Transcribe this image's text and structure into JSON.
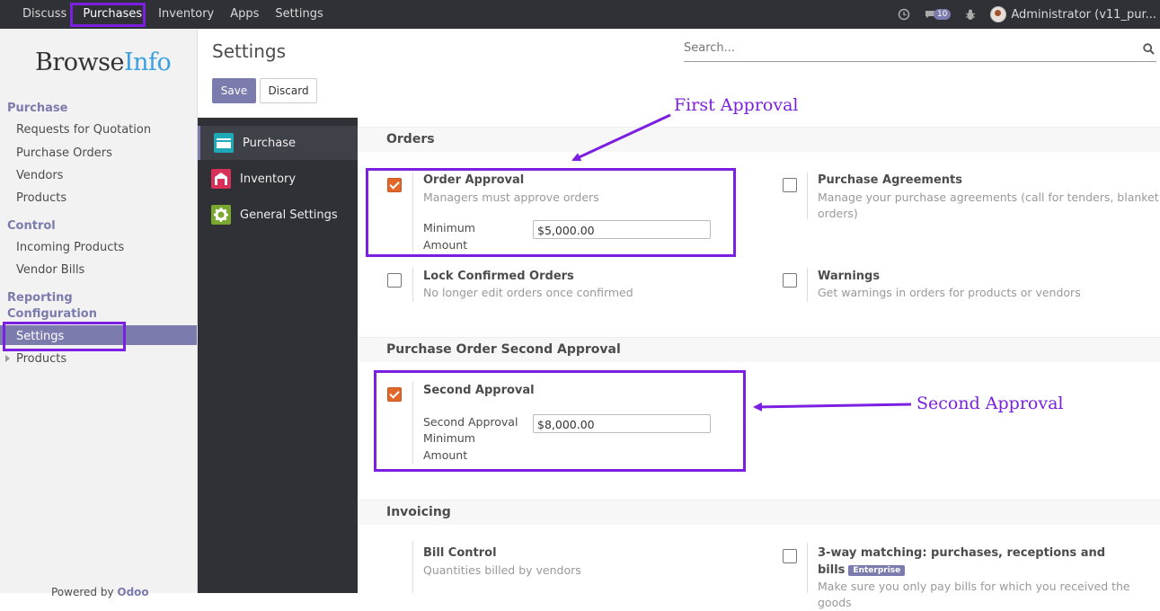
{
  "topbar": {
    "menu": [
      "Discuss",
      "Purchases",
      "Inventory",
      "Apps",
      "Settings"
    ],
    "messages_count": "10",
    "user": "Administrator (v11_pur..."
  },
  "sidebar": {
    "logo_a": "Browse",
    "logo_b": "Info",
    "sections": {
      "purchase": "Purchase",
      "control": "Control",
      "reporting": "Reporting",
      "configuration": "Configuration"
    },
    "items": {
      "rfq": "Requests for Quotation",
      "purchase_orders": "Purchase Orders",
      "vendors": "Vendors",
      "products": "Products",
      "incoming_products": "Incoming Products",
      "vendor_bills": "Vendor Bills",
      "settings": "Settings",
      "config_products": "Products"
    },
    "powered_prefix": "Powered by ",
    "powered_brand": "Odoo"
  },
  "header": {
    "title": "Settings",
    "search_placeholder": "Search...",
    "save": "Save",
    "discard": "Discard"
  },
  "settings_menu": [
    "Purchase",
    "Inventory",
    "General Settings"
  ],
  "sections": {
    "orders": "Orders",
    "second_approval": "Purchase Order Second Approval",
    "invoicing": "Invoicing"
  },
  "options": {
    "order_approval": {
      "label": "Order Approval",
      "desc": "Managers must approve orders",
      "checked": true,
      "field_label_1": "Minimum",
      "field_label_2": "Amount",
      "value": "$5,000.00"
    },
    "purchase_agreements": {
      "label": "Purchase Agreements",
      "desc_1": "Manage your purchase agreements (call for tenders, blanket",
      "desc_2": "orders)",
      "checked": false
    },
    "lock_confirmed": {
      "label": "Lock Confirmed Orders",
      "desc": "No longer edit orders once confirmed",
      "checked": false
    },
    "warnings": {
      "label": "Warnings",
      "desc": "Get warnings in orders for products or vendors",
      "checked": false
    },
    "second_approval": {
      "label": "Second Approval",
      "checked": true,
      "field_label_1": "Second Approval",
      "field_label_2": "Minimum",
      "field_label_3": "Amount",
      "value": "$8,000.00"
    },
    "bill_control": {
      "label": "Bill Control",
      "desc": "Quantities billed by vendors"
    },
    "three_way": {
      "label_1": "3-way matching: purchases, receptions and",
      "label_2": "bills",
      "badge": "Enterprise",
      "desc": "Make sure you only pay bills for which you received the goods",
      "checked": false
    }
  },
  "annotations": {
    "first": "First Approval",
    "second": "Second Approval"
  },
  "colors": {
    "accent": "#7c7bad",
    "annotation": "#7b1fe0",
    "checkbox_on": "#e1672b",
    "topbar": "#2f3136"
  }
}
